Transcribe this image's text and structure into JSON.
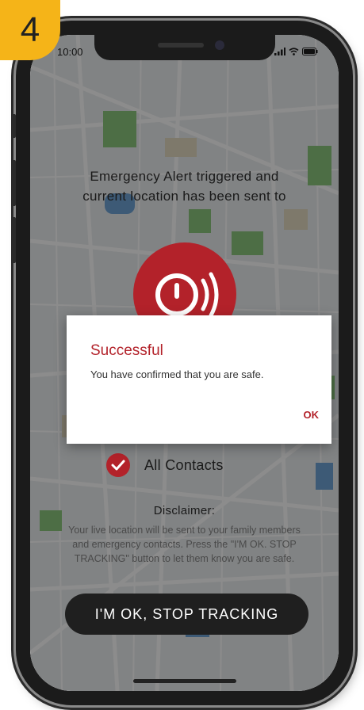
{
  "step": {
    "number": "4",
    "color": "#f5b418"
  },
  "status_bar": {
    "time": "10:00",
    "icons": [
      "signal-icon",
      "wifi-icon",
      "battery-icon"
    ]
  },
  "alert": {
    "line1": "Emergency Alert triggered and",
    "line2": "current location has been sent to",
    "button_icon": "emergency-siren-icon",
    "accent_color": "#b3222a"
  },
  "contacts": {
    "label": "All Contacts",
    "checked": true
  },
  "disclaimer": {
    "title": "Disclaimer:",
    "body": "Your live location will be sent to your family members and emergency contacts. Press the \"I'M OK. STOP TRACKING\" button to let them know you are safe."
  },
  "stop_button": {
    "label": "I'M OK, STOP TRACKING"
  },
  "dialog": {
    "title": "Successful",
    "message": "You have confirmed that you are safe.",
    "ok_label": "OK"
  }
}
